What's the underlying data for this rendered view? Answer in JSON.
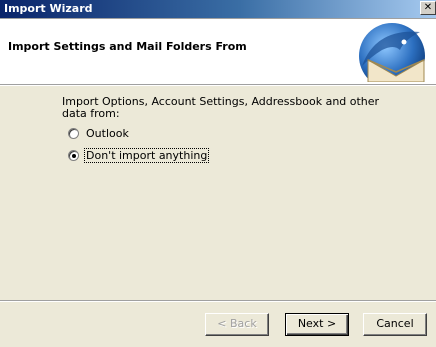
{
  "window": {
    "title": "Import Wizard",
    "close_glyph": "✕"
  },
  "header": {
    "title": "Import Settings and Mail Folders From",
    "logo_icon": "thunderbird-logo"
  },
  "main": {
    "description": "Import Options, Account Settings, Addressbook and other data from:",
    "options": [
      {
        "label": "Outlook",
        "selected": false
      },
      {
        "label": "Don't import anything",
        "selected": true
      }
    ]
  },
  "footer": {
    "back_label": "< Back",
    "next_label": "Next >",
    "cancel_label": "Cancel"
  },
  "colors": {
    "titlebar_start": "#0a246a",
    "dialog_bg": "#ece9d8",
    "header_bg": "#ffffff"
  }
}
